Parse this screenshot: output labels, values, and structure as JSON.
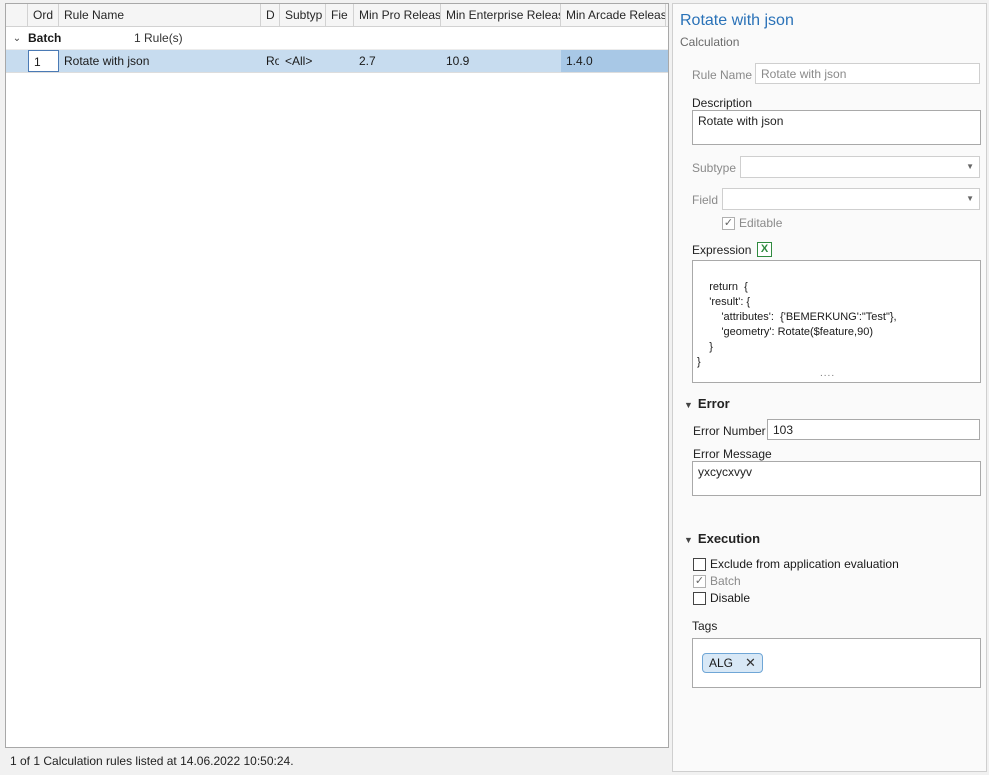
{
  "grid": {
    "columns": [
      "",
      "Ord",
      "Rule Name",
      "D",
      "Subtyp",
      "Fie",
      "Min Pro Releas",
      "Min Enterprise Releas",
      "Min Arcade Releas"
    ],
    "group": {
      "name": "Batch",
      "count": "1 Rule(s)"
    },
    "rows": [
      {
        "ord": "1",
        "rule_name": "Rotate with json",
        "d": "Ro",
        "subtype": "<All>",
        "field": "",
        "min_pro": "2.7",
        "min_enterprise": "10.9",
        "min_arcade": "1.4.0"
      }
    ]
  },
  "status": "1 of 1 Calculation rules listed at 14.06.2022 10:50:24.",
  "detail": {
    "title": "Rotate with json",
    "subtitle": "Calculation",
    "rule_name_label": "Rule Name",
    "rule_name_value": "Rotate with json",
    "description_label": "Description",
    "description_value": "Rotate with json",
    "subtype_label": "Subtype",
    "field_label": "Field",
    "editable_label": "Editable",
    "expression_label": "Expression",
    "expression_value": "return  {\n    'result': {\n        'attributes':  {'BEMERKUNG':\"Test\"},\n        'geometry': Rotate($feature,90)\n    }\n}",
    "error_section": "Error",
    "error_number_label": "Error Number",
    "error_number_value": "103",
    "error_message_label": "Error Message",
    "error_message_value": "yxcycxvyv",
    "execution_section": "Execution",
    "exclude_label": "Exclude from application evaluation",
    "batch_label": "Batch",
    "disable_label": "Disable",
    "tags_label": "Tags",
    "tags": [
      "ALG"
    ]
  },
  "icons": {
    "expand": "chevron-down-icon",
    "excel": "excel-icon",
    "remove": "close-icon"
  }
}
